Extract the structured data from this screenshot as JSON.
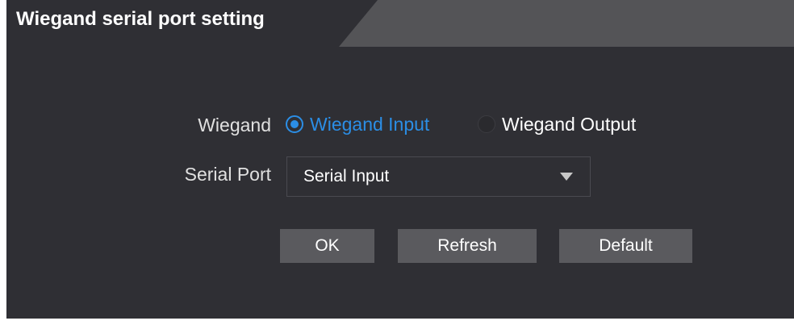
{
  "page": {
    "title": "Wiegand serial port setting"
  },
  "wiegand": {
    "label": "Wiegand",
    "options": [
      {
        "label": "Wiegand Input",
        "selected": true
      },
      {
        "label": "Wiegand Output",
        "selected": false
      }
    ]
  },
  "serial_port": {
    "label": "Serial Port",
    "selected_value": "Serial Input"
  },
  "buttons": {
    "ok": "OK",
    "refresh": "Refresh",
    "default": "Default"
  },
  "colors": {
    "panel_background": "#2f2f34",
    "tab_strip": "#545457",
    "accent": "#2b8ee6",
    "button": "#5a5a5e"
  },
  "icons": {
    "dropdown": "chevron-down-icon"
  }
}
